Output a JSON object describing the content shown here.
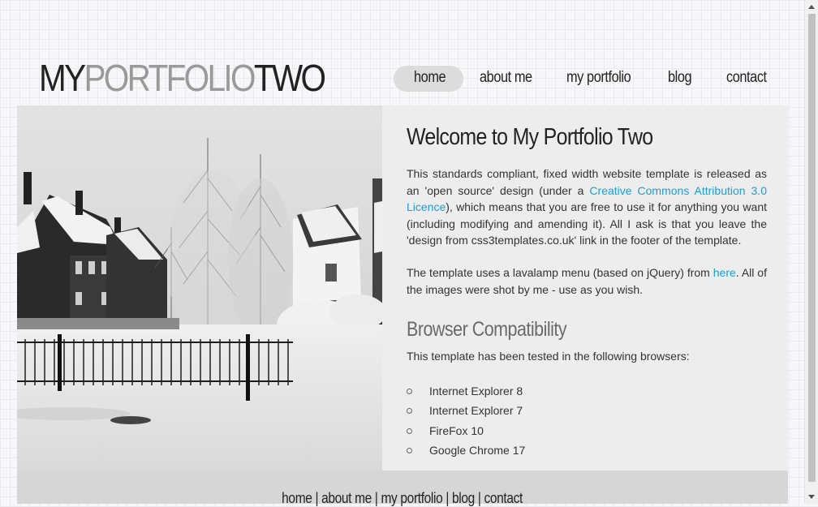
{
  "site": {
    "logo": {
      "part1": "MY",
      "part2": "PORTFOLIO",
      "part3": "TWO"
    }
  },
  "nav": {
    "items": [
      {
        "label": "home",
        "active": true
      },
      {
        "label": "about me",
        "active": false
      },
      {
        "label": "my portfolio",
        "active": false
      },
      {
        "label": "blog",
        "active": false
      },
      {
        "label": "contact",
        "active": false
      }
    ]
  },
  "content": {
    "heading": "Welcome to My Portfolio Two",
    "intro": {
      "before_link": "This standards compliant, fixed width website template is released as an 'open source' design (under a ",
      "link": "Creative Commons Attribution 3.0 Licence",
      "after_link": "), which means that you are free to use it for anything you want (including modifying and amending it). All I ask is that you leave the 'design from css3templates.co.uk' link in the footer of the template."
    },
    "lavalamp": {
      "before_link": "The template uses a lavalamp menu (based on jQuery) from ",
      "link": "here",
      "after_link": ". All of the images were shot by me - use as you wish."
    },
    "compat_heading": "Browser Compatibility",
    "compat_text": "This template has been tested in the following browsers:",
    "browsers": [
      "Internet Explorer 8",
      "Internet Explorer 7",
      "FireFox 10",
      "Google Chrome 17"
    ]
  },
  "footer": {
    "links": [
      "home",
      "about me",
      "my portfolio",
      "blog",
      "contact"
    ],
    "separator": " | "
  },
  "colors": {
    "link": "#1a9fd9",
    "text": "#333333",
    "panel": "#ededed",
    "footer": "#d6d6d6",
    "nav_highlight": "#dcdcdc"
  },
  "image": {
    "description_icon": "photo"
  }
}
